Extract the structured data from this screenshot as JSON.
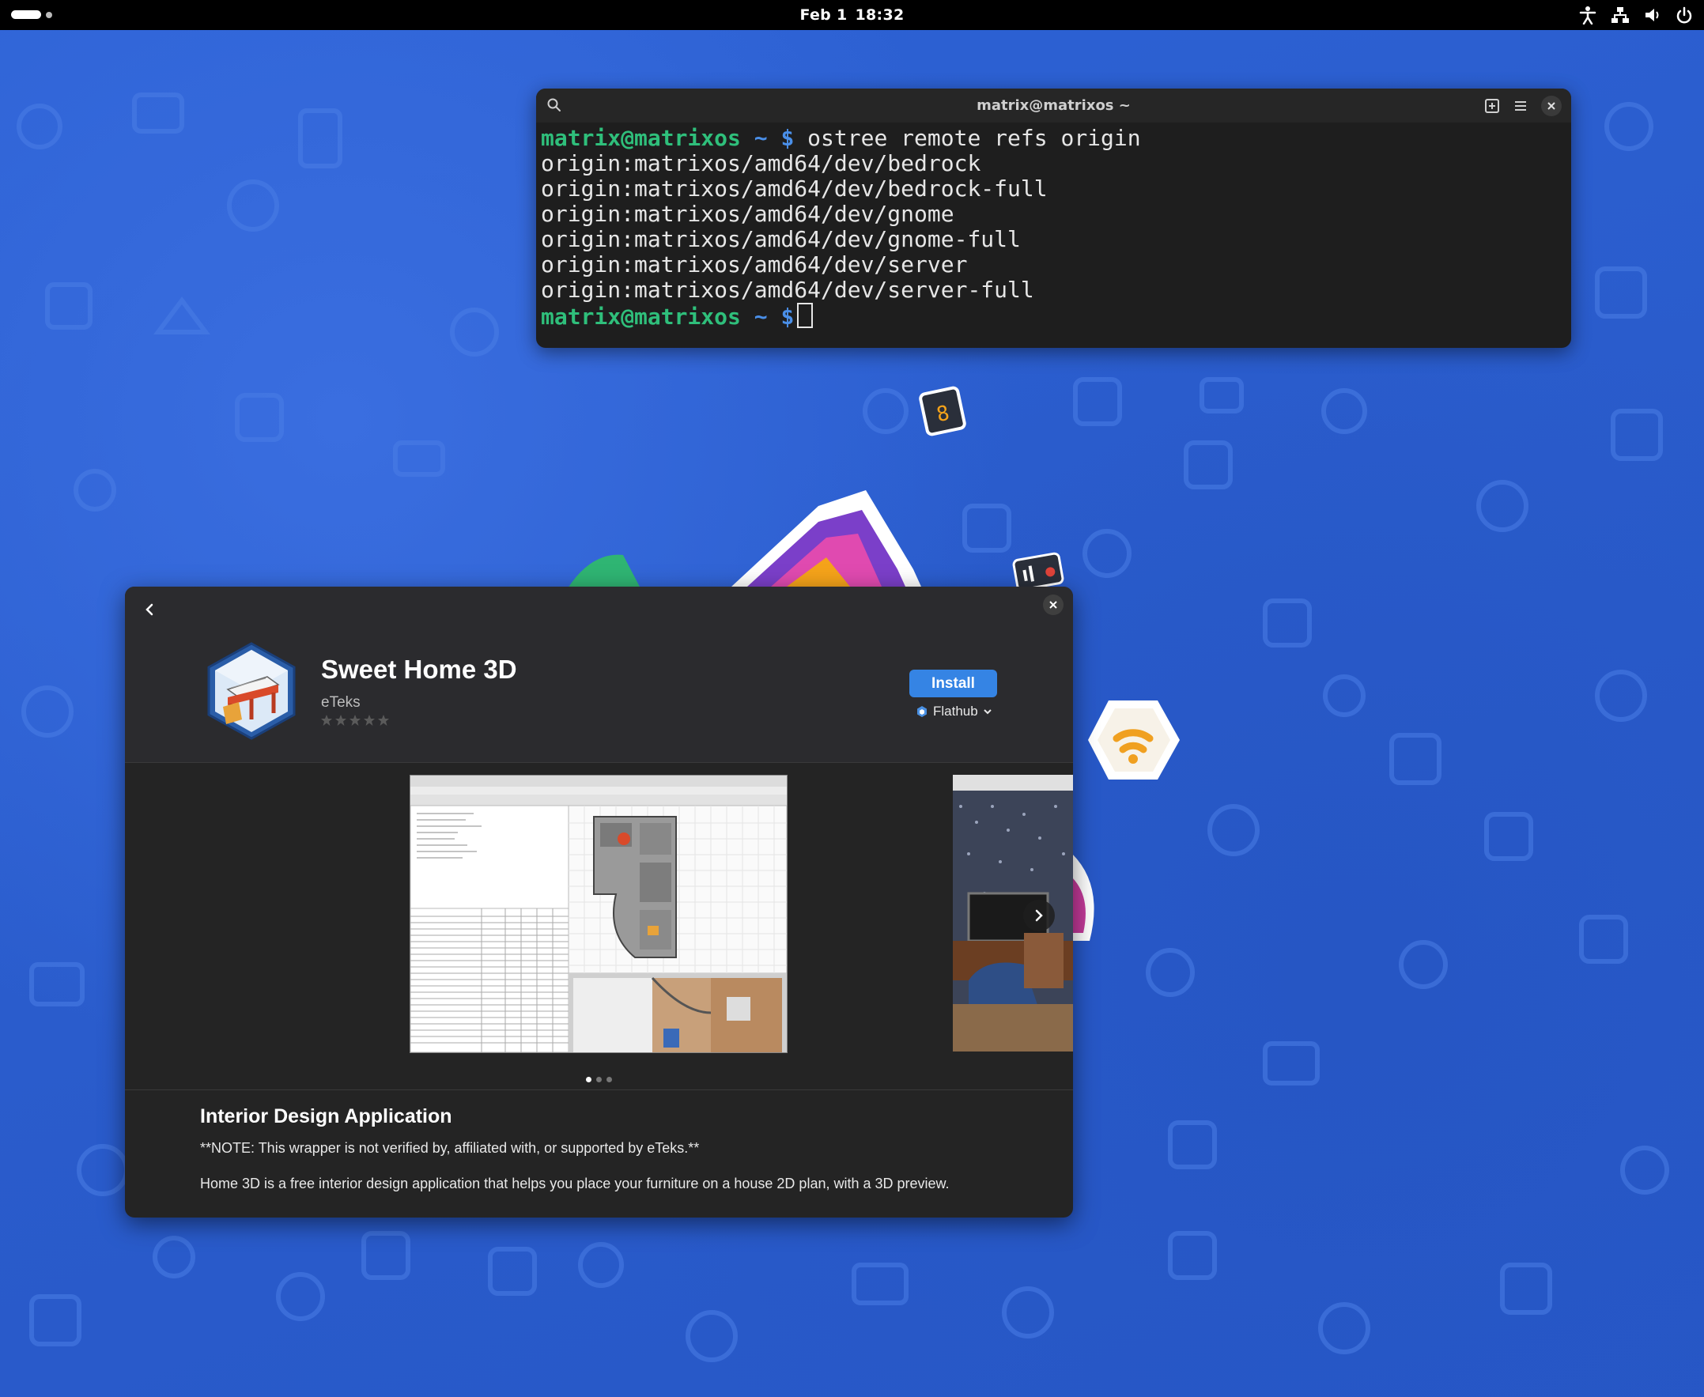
{
  "topbar": {
    "date": "Feb 1",
    "time": "18:32",
    "icons": [
      "accessibility-icon",
      "network-icon",
      "volume-icon",
      "power-icon"
    ]
  },
  "terminal": {
    "title": "matrix@matrixos ~",
    "prompt_user": "matrix@matrixos",
    "prompt_path": "~ $",
    "command": "ostree remote refs origin",
    "output": [
      "origin:matrixos/amd64/dev/bedrock",
      "origin:matrixos/amd64/dev/bedrock-full",
      "origin:matrixos/amd64/dev/gnome",
      "origin:matrixos/amd64/dev/gnome-full",
      "origin:matrixos/amd64/dev/server",
      "origin:matrixos/amd64/dev/server-full"
    ]
  },
  "store": {
    "app_name": "Sweet Home 3D",
    "developer": "eTeks",
    "rating_stars": 0,
    "install_label": "Install",
    "source_label": "Flathub",
    "screenshot_count": 3,
    "active_screenshot": 0,
    "description_title": "Interior Design Application",
    "note": "**NOTE: This wrapper is not verified by, affiliated with, or supported by eTeks.**",
    "description": "Home 3D is a free interior design application that helps you place your furniture on a house 2D plan, with a 3D preview."
  },
  "colors": {
    "accent": "#3584e4",
    "terminal_green": "#2fbf7b",
    "terminal_blue": "#4a8fe8",
    "wallpaper": "#2b5fd0"
  }
}
